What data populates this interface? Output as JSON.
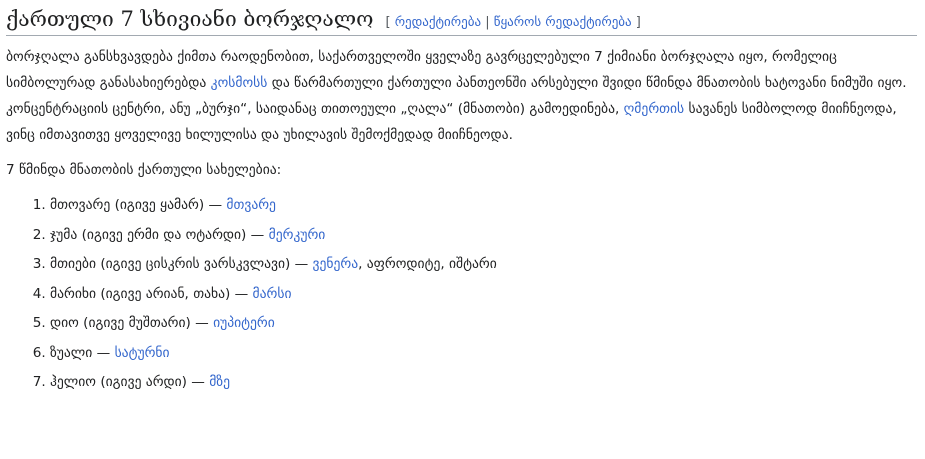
{
  "section": {
    "title": "ქართული 7 სხივიანი ბორჯღალო",
    "edit_open": "[ ",
    "edit_label": "რედაქტირება",
    "edit_sep": " | ",
    "edit_source_label": "წყაროს რედაქტირება",
    "edit_close": " ]"
  },
  "intro": {
    "text1": "ბორჯღალა განსხვავდება ქიმთა რაოდენობით, საქართველოში ყველაზე გავრცელებული 7 ქიმიანი ბორჯღალა იყო, რომელიც სიმბოლურად განასახიერებდა ",
    "link_cosmos": "კოსმოსს",
    "text2": " და წარმართული ქართული პანთეონში არსებული შვიდი წმინდა მნათობის ხატოვანი ნიმუში იყო. კონცენტრაციის ცენტრი, ანუ „ბურჯი“, საიდანაც თითოეული „ღალა“ (მნათობი) გამოედინება, ",
    "link_gods": "ღმერთის",
    "text3": " სავანეს სიმბოლოდ მიიჩნეოდა, ვინც იმთავითვე ყოველივე ხილულისა და უხილავის შემოქმედად მიიჩნეოდა."
  },
  "list_intro": "7 წმინდა მნათობის ქართული სახელებია:",
  "luminaries": [
    {
      "text": "მთოვარე (იგივე ყამარ) — ",
      "link": "მთვარე",
      "suffix": ""
    },
    {
      "text": "ჯუმა (იგივე ერმი და ოტარდი) — ",
      "link": "მერკური",
      "suffix": ""
    },
    {
      "text": "მთიები (იგივე ცისკრის ვარსკვლავი) — ",
      "link": "ვენერა",
      "suffix": ", აფროდიტე, იშტარი"
    },
    {
      "text": "მარიხი (იგივე არიან, თახა) — ",
      "link": "მარსი",
      "suffix": ""
    },
    {
      "text": "დიო (იგივე მუშთარი) — ",
      "link": "იუპიტერი",
      "suffix": ""
    },
    {
      "text": "ზუალი — ",
      "link": "სატურნი",
      "suffix": ""
    },
    {
      "text": "ჰელიო (იგივე არდი) — ",
      "link": "მზე",
      "suffix": ""
    }
  ],
  "colors": {
    "text": "#202122",
    "link": "#3366cc",
    "rule": "#a2a9b1"
  }
}
